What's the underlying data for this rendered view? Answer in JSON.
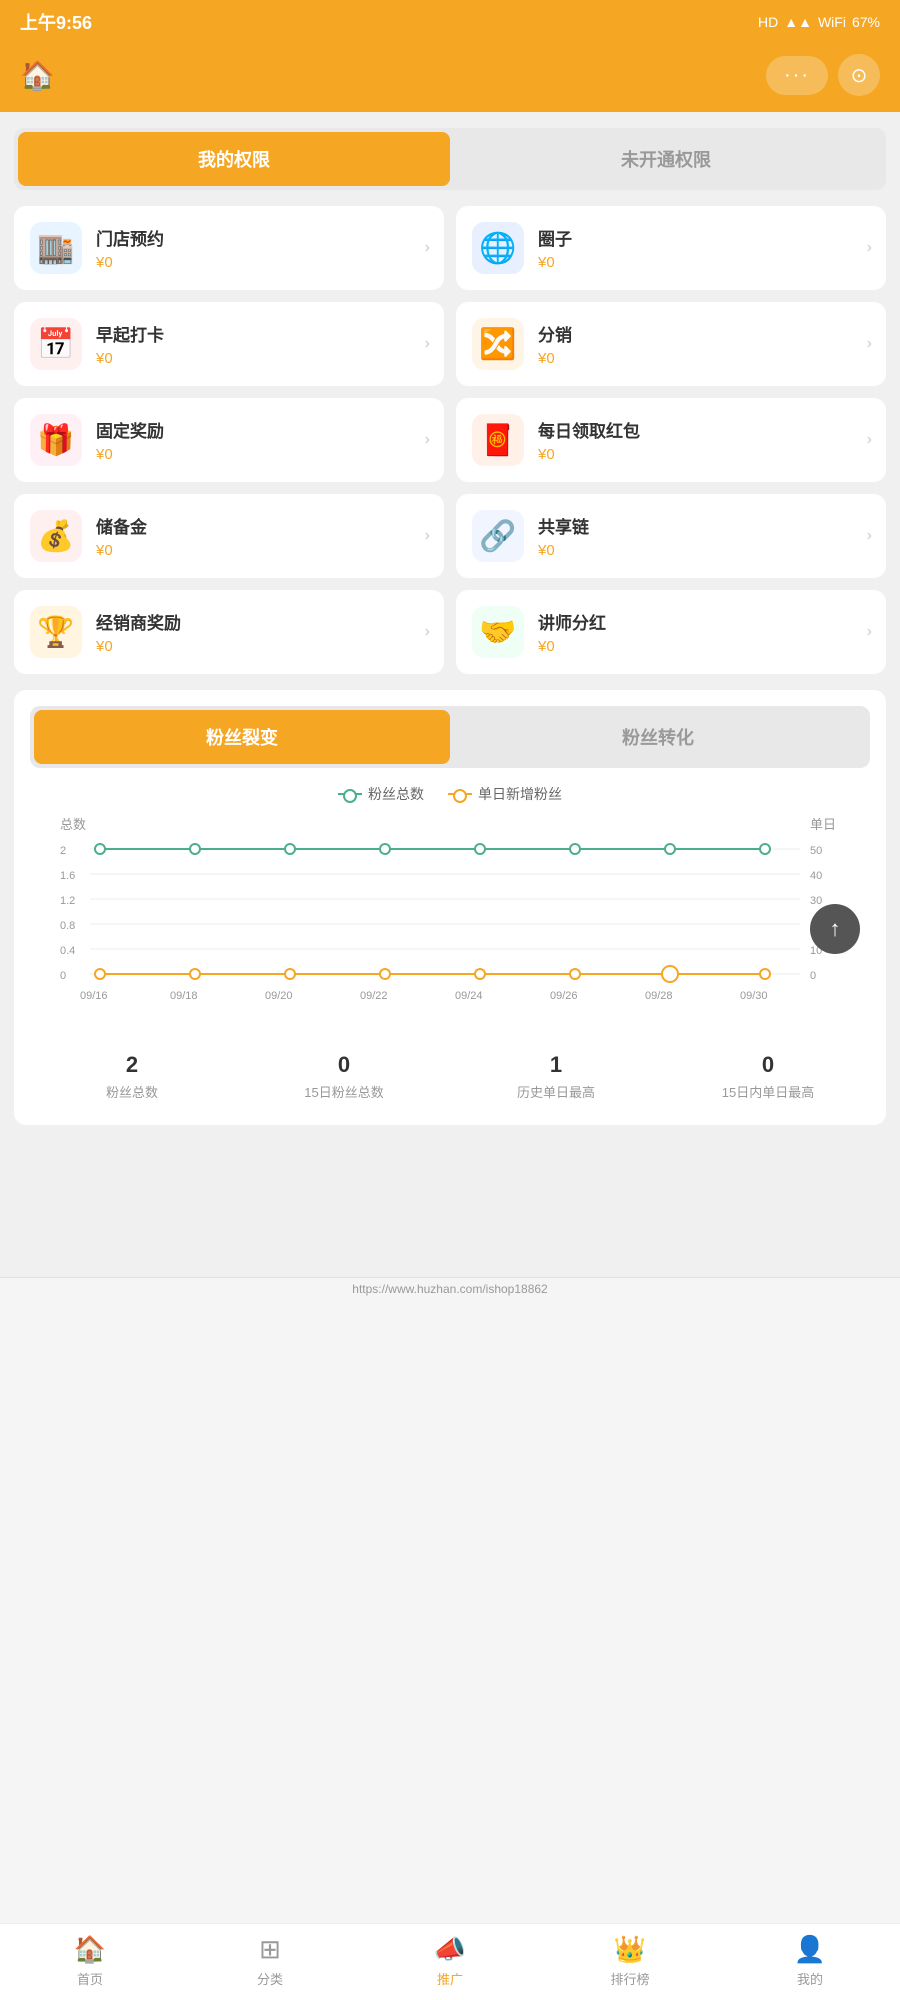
{
  "statusBar": {
    "time": "上午9:56",
    "icons": "HD ▲▲ ▲▲ ⓦ 67"
  },
  "header": {
    "homeIcon": "🏠",
    "dotsLabel": "···",
    "cameraIcon": "⊙"
  },
  "tabs": {
    "active": "我的权限",
    "inactive": "未开通权限"
  },
  "permissions": [
    {
      "name": "门店预约",
      "value": "¥0",
      "icon": "🏬",
      "iconBg": "#e8f4ff"
    },
    {
      "name": "圈子",
      "value": "¥0",
      "icon": "🌐",
      "iconBg": "#e8f0ff"
    },
    {
      "name": "早起打卡",
      "value": "¥0",
      "icon": "📅",
      "iconBg": "#fff0f0"
    },
    {
      "name": "分销",
      "value": "¥0",
      "icon": "🔀",
      "iconBg": "#fff5e6"
    },
    {
      "name": "固定奖励",
      "value": "¥0",
      "icon": "🎁",
      "iconBg": "#fff0f5"
    },
    {
      "name": "每日领取红包",
      "value": "¥0",
      "icon": "🧧",
      "iconBg": "#fff0e8"
    },
    {
      "name": "储备金",
      "value": "¥0",
      "icon": "💰",
      "iconBg": "#fff0f0"
    },
    {
      "name": "共享链",
      "value": "¥0",
      "icon": "🔗",
      "iconBg": "#f0f5ff"
    },
    {
      "name": "经销商奖励",
      "value": "¥0",
      "icon": "🏆",
      "iconBg": "#fff5e0"
    },
    {
      "name": "讲师分红",
      "value": "¥0",
      "icon": "🤝",
      "iconBg": "#f0fff5"
    }
  ],
  "fanSection": {
    "tab1": "粉丝裂变",
    "tab2": "粉丝转化",
    "legend1": "粉丝总数",
    "legend2": "单日新增粉丝",
    "yLeft": "总数",
    "yRight": "单日",
    "xLabels": [
      "09/16",
      "09/18",
      "09/20",
      "09/22",
      "09/24",
      "09/26",
      "09/28",
      "09/30"
    ],
    "stats": [
      {
        "value": "2",
        "label": "粉丝总数"
      },
      {
        "value": "0",
        "label": "15日粉丝总数"
      },
      {
        "value": "1",
        "label": "历史单日最高"
      },
      {
        "value": "0",
        "label": "15日内单日最高"
      }
    ]
  },
  "bottomNav": [
    {
      "label": "首页",
      "icon": "🏠",
      "active": false
    },
    {
      "label": "分类",
      "icon": "⊞",
      "active": false
    },
    {
      "label": "推广",
      "icon": "📣",
      "active": true
    },
    {
      "label": "排行榜",
      "icon": "👑",
      "active": false
    },
    {
      "label": "我的",
      "icon": "👤",
      "active": false
    }
  ],
  "urlBar": "https://www.huzhan.com/ishop18862",
  "phoneBottom": [
    "≡",
    "○",
    "<"
  ]
}
